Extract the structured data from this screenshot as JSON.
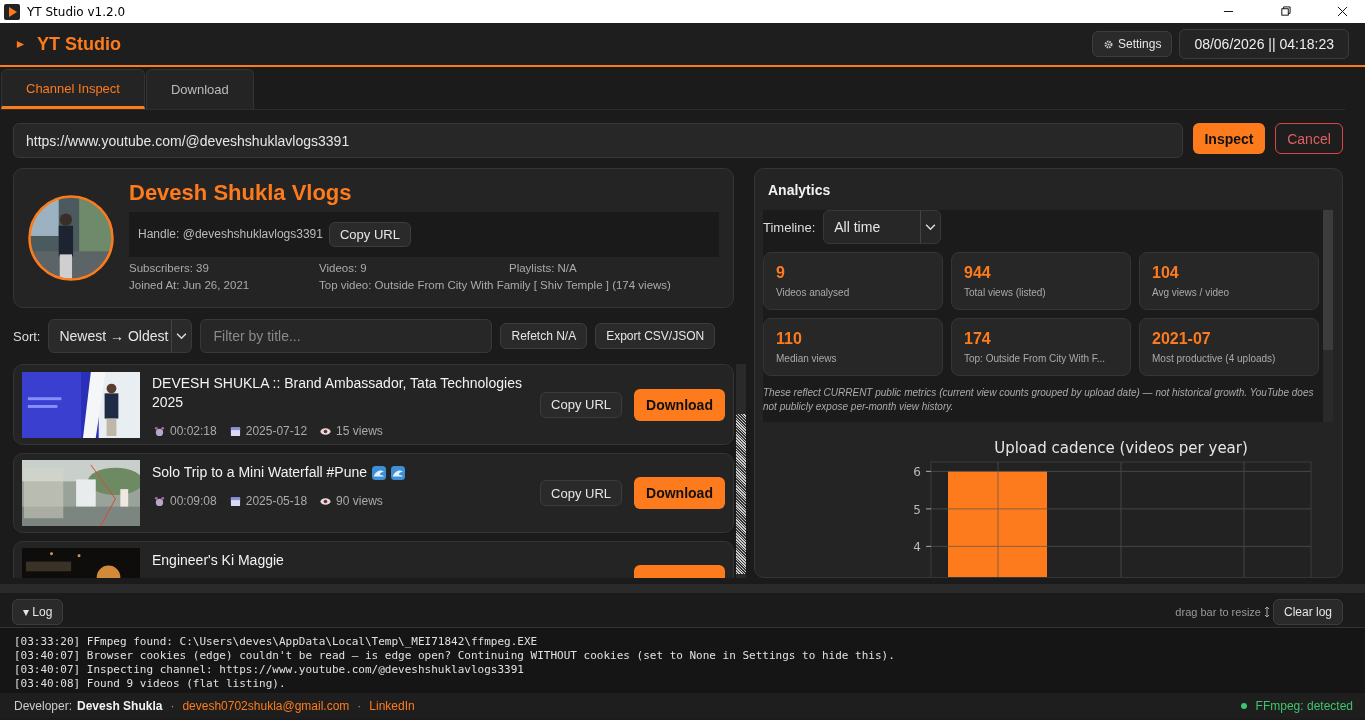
{
  "window": {
    "title": "YT Studio v1.2.0"
  },
  "header": {
    "app_name": "YT Studio",
    "settings": "Settings",
    "datetime": "08/06/2026 || 04:18:23"
  },
  "tabs": [
    {
      "label": "Channel Inspect",
      "selected": true
    },
    {
      "label": "Download",
      "selected": false
    }
  ],
  "url_bar": {
    "value": "https://www.youtube.com/@deveshshuklavlogs3391",
    "inspect": "Inspect",
    "cancel": "Cancel"
  },
  "channel": {
    "name": "Devesh Shukla Vlogs",
    "handle": "Handle: @deveshshuklavlogs3391",
    "copy": "Copy URL",
    "stats": [
      [
        "Subscribers: 39",
        "Videos: 9",
        "Playlists: N/A"
      ],
      [
        "Joined At: Jun 26, 2021",
        "Top video: Outside From City With Family [ Shiv Temple ] (174 views)"
      ]
    ]
  },
  "toolbar": {
    "sort_label": "Sort:",
    "sort_value": "Newest → Oldest",
    "filter_placeholder": "Filter by title...",
    "refetch": "Refetch N/A",
    "export": "Export CSV/JSON"
  },
  "videos": [
    {
      "title": "DEVESH SHUKLA :: Brand Ambassador, Tata Technologies 2025",
      "emoji": false,
      "duration": "00:02:18",
      "date": "2025-07-12",
      "views": "15 views",
      "copy": "Copy URL",
      "download": "Download"
    },
    {
      "title": "Solo Trip to a Mini Waterfall #Pune",
      "emoji": true,
      "duration": "00:09:08",
      "date": "2025-05-18",
      "views": "90 views",
      "copy": "Copy URL",
      "download": "Download"
    },
    {
      "title": "Engineer's Ki Maggie",
      "emoji": false
    }
  ],
  "analytics": {
    "title": "Analytics",
    "timeline_label": "Timeline:",
    "timeline_value": "All time",
    "cards": [
      {
        "value": "9",
        "label": "Videos analysed"
      },
      {
        "value": "944",
        "label": "Total views (listed)"
      },
      {
        "value": "104",
        "label": "Avg views / video"
      },
      {
        "value": "110",
        "label": "Median views"
      },
      {
        "value": "174",
        "label": "Top: Outside From City With F..."
      },
      {
        "value": "2021-07",
        "label": "Most productive (4 uploads)"
      }
    ],
    "note": "These reflect CURRENT public metrics (current view counts grouped by upload date) — not historical growth. YouTube does not publicly expose per-month view history.",
    "chart_data": {
      "type": "bar",
      "title": "Upload cadence (videos per year)",
      "values": [
        6
      ],
      "ylim": [
        0,
        6.25
      ],
      "yticks": [
        4,
        5,
        6
      ],
      "grid": true
    }
  },
  "log": {
    "toggle": "▾ Log",
    "hint": "drag bar to resize",
    "clear": "Clear log",
    "lines": [
      "[03:33:20] FFmpeg found: C:\\Users\\deves\\AppData\\Local\\Temp\\_MEI71842\\ffmpeg.EXE",
      "[03:40:07] Browser cookies (edge) couldn't be read — is edge open? Continuing WITHOUT cookies (set to None in Settings to hide this).",
      "[03:40:07] Inspecting channel: https://www.youtube.com/@deveshshuklavlogs3391",
      "[03:40:08] Found 9 videos (flat listing)."
    ]
  },
  "footer": {
    "label": "Developer:",
    "name": "Devesh Shukla",
    "sep": "·",
    "email": "devesh0702shukla@gmail.com",
    "link": "LinkedIn",
    "status": "FFmpeg: detected",
    "status_ok": true
  }
}
